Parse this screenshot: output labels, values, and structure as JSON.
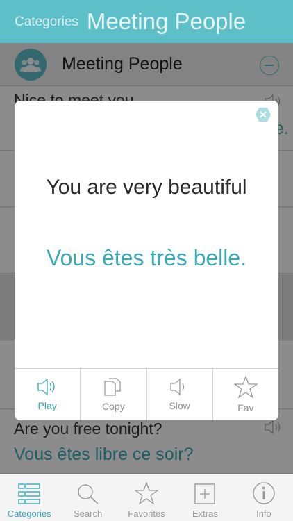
{
  "header": {
    "back_label": "Categories",
    "title": "Meeting People"
  },
  "category": {
    "label": "Meeting People",
    "icon": "people-icon"
  },
  "list": {
    "top_row": {
      "english": "Nice to meet you",
      "french_fragment": "e."
    },
    "bottom_row": {
      "english": "Are you free tonight?",
      "french": "Vous êtes libre ce soir?"
    }
  },
  "modal": {
    "english": "You are very beautiful",
    "french": "Vous êtes très belle.",
    "actions": [
      {
        "label": "Play",
        "icon": "speaker-icon"
      },
      {
        "label": "Copy",
        "icon": "copy-icon"
      },
      {
        "label": "Slow",
        "icon": "speaker-slow-icon"
      },
      {
        "label": "Fav",
        "icon": "star-icon"
      }
    ]
  },
  "tabbar": {
    "tabs": [
      {
        "label": "Categories",
        "icon": "categories-icon",
        "active": true
      },
      {
        "label": "Search",
        "icon": "search-icon",
        "active": false
      },
      {
        "label": "Favorites",
        "icon": "star-icon",
        "active": false
      },
      {
        "label": "Extras",
        "icon": "plus-icon",
        "active": false
      },
      {
        "label": "Info",
        "icon": "info-icon",
        "active": false
      }
    ]
  },
  "colors": {
    "accent": "#5dbfc8",
    "accent_text": "#3aa9b5",
    "inactive": "#9a9a9a"
  }
}
